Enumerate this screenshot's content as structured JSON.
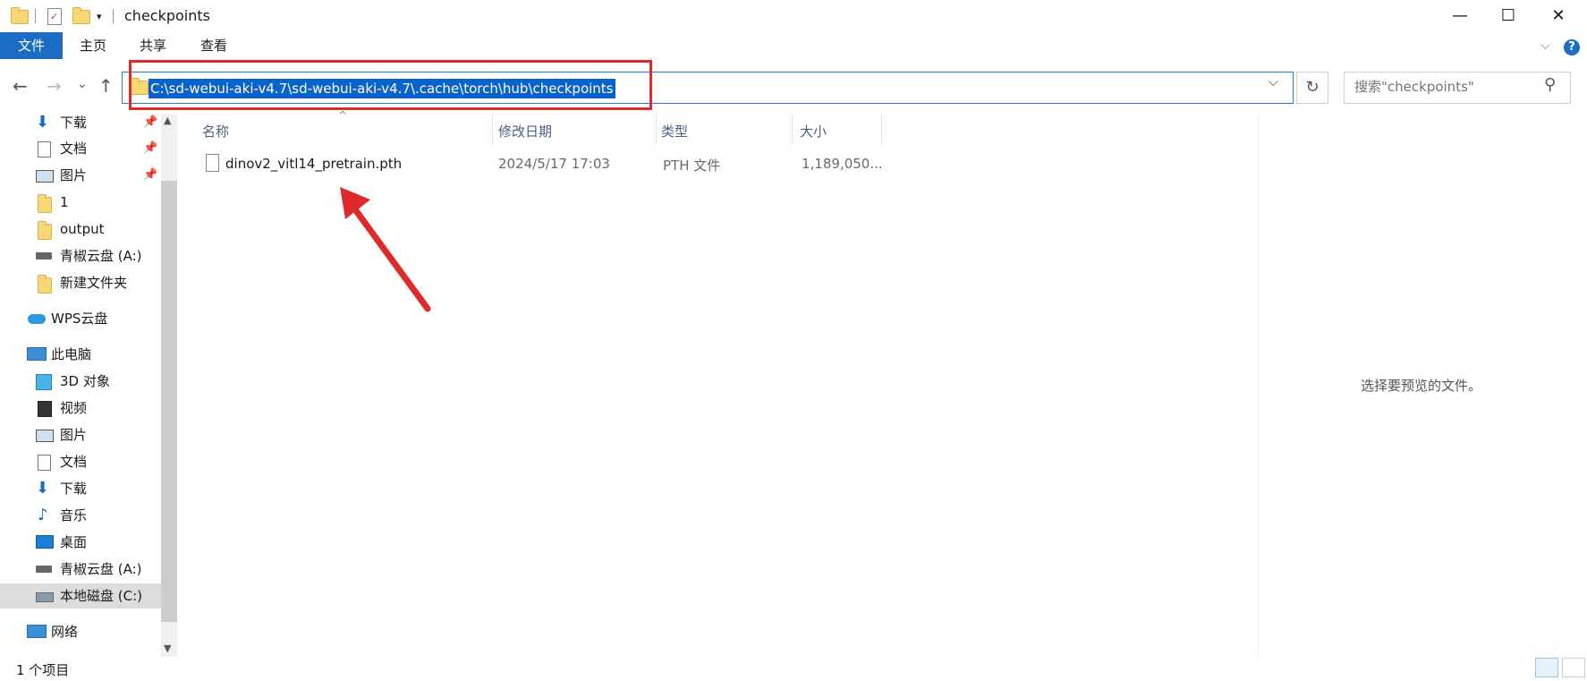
{
  "window": {
    "title": "checkpoints",
    "controls": {
      "minimize": "—",
      "maximize": "☐",
      "close": "✕"
    }
  },
  "ribbon": {
    "tabs": [
      {
        "label": "文件",
        "active": true
      },
      {
        "label": "主页"
      },
      {
        "label": "共享"
      },
      {
        "label": "查看"
      }
    ],
    "expand_glyph": "⌵",
    "help_glyph": "?"
  },
  "address": {
    "path": "C:\\sd-webui-aki-v4.7\\sd-webui-aki-v4.7\\.cache\\torch\\hub\\checkpoints",
    "refresh_glyph": "↻",
    "dropdown_glyph": "⌵"
  },
  "search": {
    "placeholder": "搜索\"checkpoints\""
  },
  "nav_glyphs": {
    "back": "←",
    "forward": "→",
    "recent": "⌄",
    "up": "↑"
  },
  "sidebar": {
    "items": [
      {
        "label": "下载",
        "icon": "download-icon",
        "pinned": true
      },
      {
        "label": "文档",
        "icon": "document-icon",
        "pinned": true
      },
      {
        "label": "图片",
        "icon": "picture-icon",
        "pinned": true
      },
      {
        "label": "1",
        "icon": "folder-icon"
      },
      {
        "label": "output",
        "icon": "folder-icon"
      },
      {
        "label": "青椒云盘 (A:)",
        "icon": "network-drive-icon"
      },
      {
        "label": "新建文件夹",
        "icon": "folder-icon"
      },
      {
        "label": "WPS云盘",
        "icon": "cloud-icon"
      },
      {
        "label": "此电脑",
        "icon": "computer-icon"
      },
      {
        "label": "3D 对象",
        "icon": "cube-icon"
      },
      {
        "label": "视频",
        "icon": "video-icon"
      },
      {
        "label": "图片",
        "icon": "picture-icon"
      },
      {
        "label": "文档",
        "icon": "document-icon"
      },
      {
        "label": "下载",
        "icon": "download-icon"
      },
      {
        "label": "音乐",
        "icon": "music-icon"
      },
      {
        "label": "桌面",
        "icon": "desktop-icon"
      },
      {
        "label": "青椒云盘 (A:)",
        "icon": "network-drive-icon"
      },
      {
        "label": "本地磁盘 (C:)",
        "icon": "local-disk-icon",
        "selected": true
      },
      {
        "label": "网络",
        "icon": "network-icon"
      }
    ]
  },
  "columns": [
    "名称",
    "修改日期",
    "类型",
    "大小"
  ],
  "files": [
    {
      "name": "dinov2_vitl14_pretrain.pth",
      "modified": "2024/5/17 17:03",
      "type": "PTH 文件",
      "size": "1,189,050..."
    }
  ],
  "preview": {
    "message": "选择要预览的文件。"
  },
  "status": {
    "item_count": "1 个项目"
  },
  "colors": {
    "accent": "#1a6dc2",
    "selection": "#0a63c9",
    "annotation": "#e02a2a"
  }
}
